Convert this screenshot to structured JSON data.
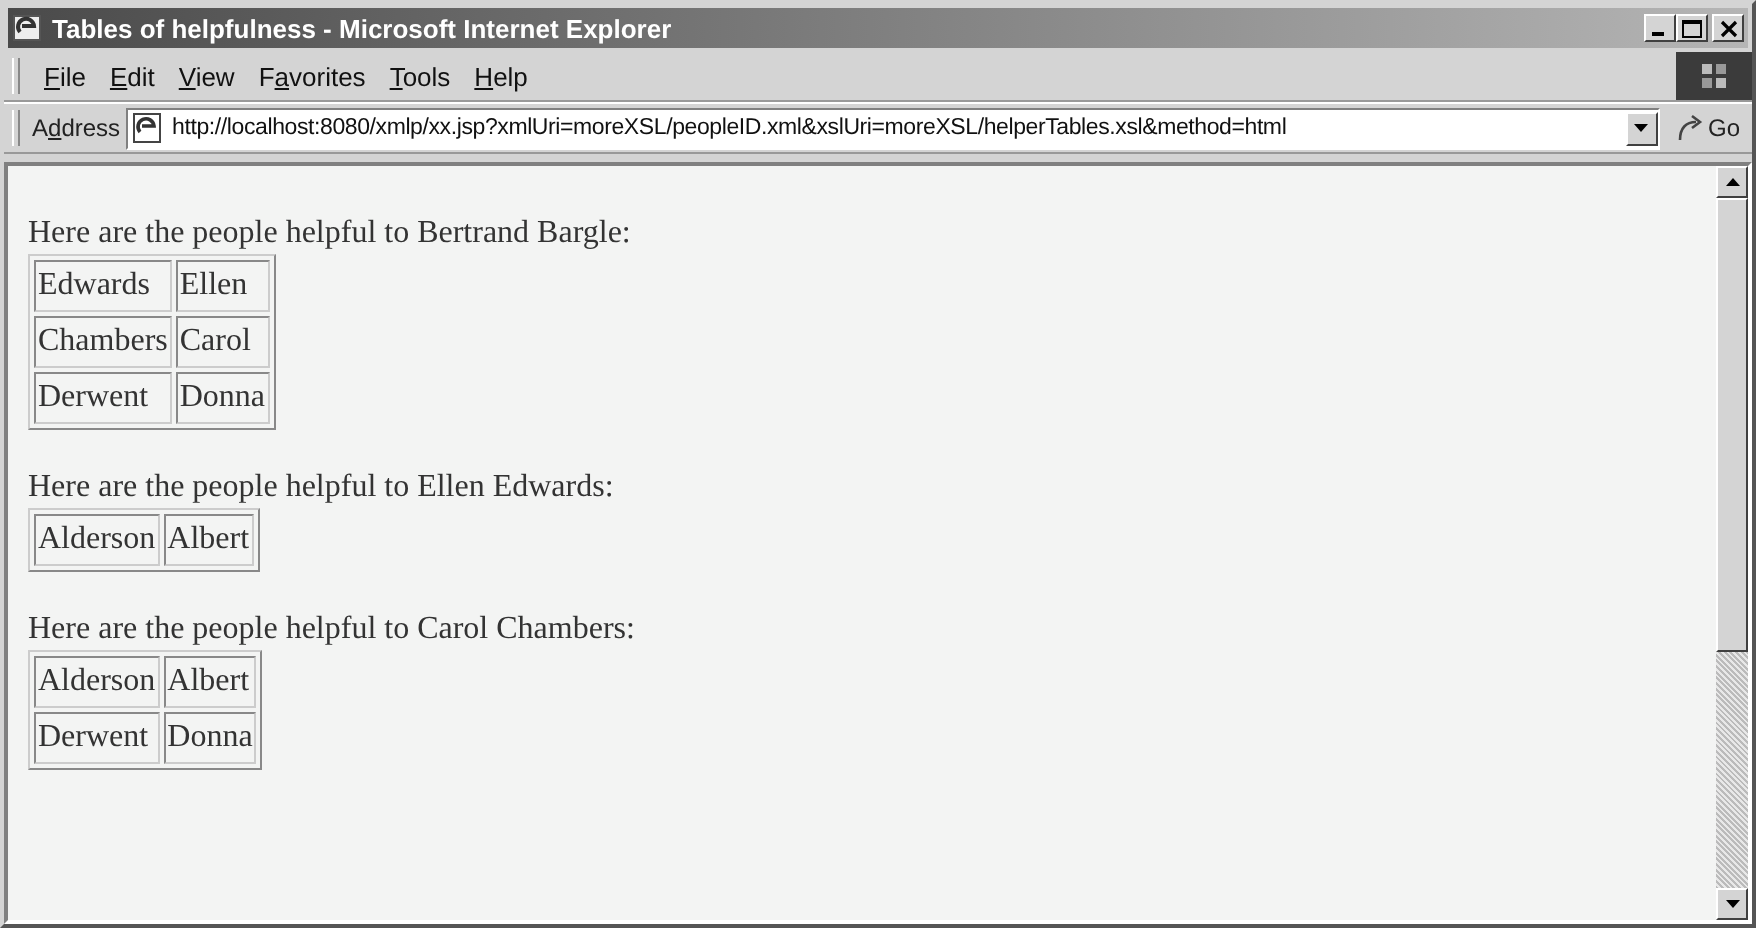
{
  "window": {
    "title": "Tables of helpfulness - Microsoft Internet Explorer"
  },
  "menu": [
    {
      "key": "F",
      "after": "ile"
    },
    {
      "key": "E",
      "after": "dit"
    },
    {
      "key": "V",
      "after": "iew"
    },
    {
      "before": "F",
      "key": "a",
      "after": "vorites"
    },
    {
      "key": "T",
      "after": "ools"
    },
    {
      "key": "H",
      "after": "elp"
    }
  ],
  "address_bar": {
    "label_parts": [
      "A",
      "d",
      "dress"
    ],
    "value": "http://localhost:8080/xmlp/xx.jsp?xmlUri=moreXSL/peopleID.xml&xslUri=moreXSL/helperTables.xsl&method=html",
    "go": "Go"
  },
  "sections": [
    {
      "heading": "Here are the people helpful to Bertrand Bargle:",
      "rows": [
        [
          "Edwards",
          "Ellen"
        ],
        [
          "Chambers",
          "Carol"
        ],
        [
          "Derwent",
          "Donna"
        ]
      ]
    },
    {
      "heading": "Here are the people helpful to Ellen Edwards:",
      "rows": [
        [
          "Alderson",
          "Albert"
        ]
      ]
    },
    {
      "heading": "Here are the people helpful to Carol Chambers:",
      "rows": [
        [
          "Alderson",
          "Albert"
        ],
        [
          "Derwent",
          "Donna"
        ]
      ]
    }
  ]
}
